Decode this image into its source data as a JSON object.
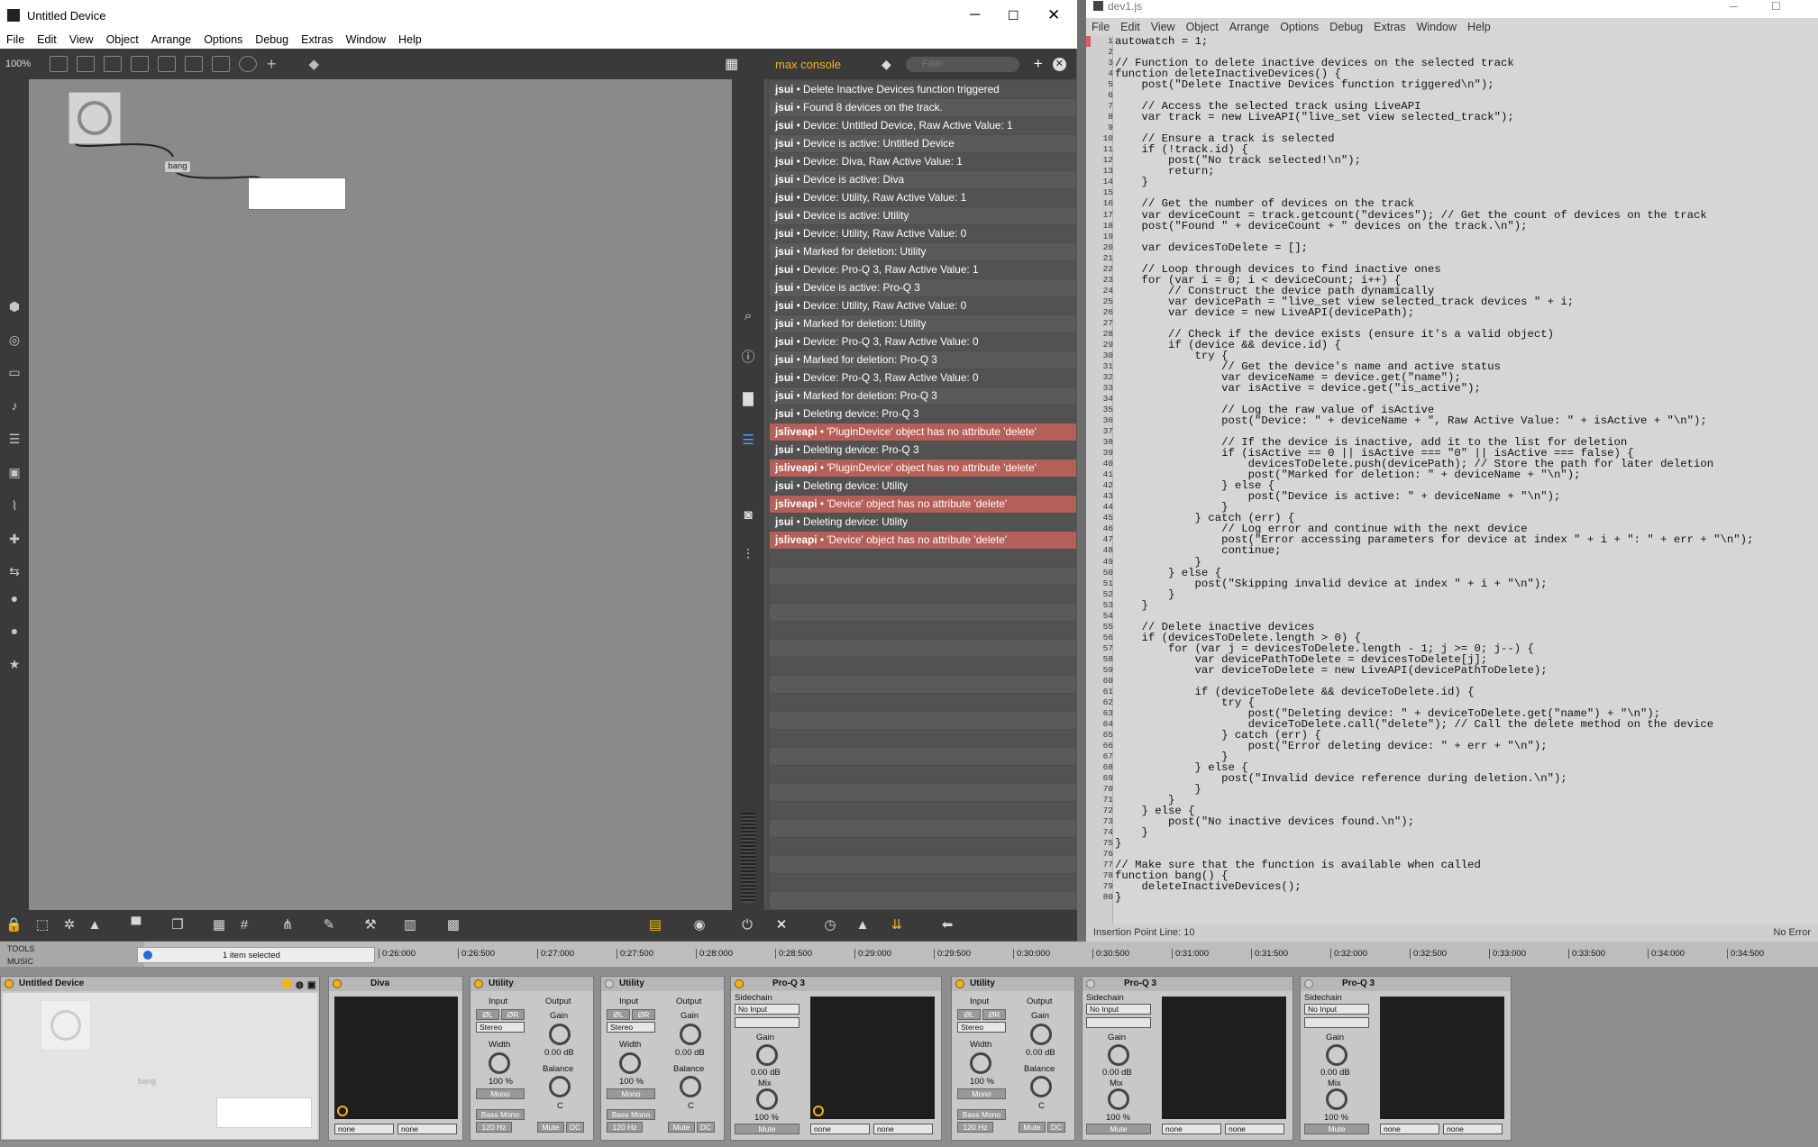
{
  "max_window": {
    "title": "Untitled Device",
    "menu": [
      "File",
      "Edit",
      "View",
      "Object",
      "Arrange",
      "Options",
      "Debug",
      "Extras",
      "Window",
      "Help"
    ],
    "zoom": "100%",
    "patch": {
      "bang_label": "bang"
    },
    "console": {
      "title": "max console",
      "filter_placeholder": "Filter",
      "rows": [
        {
          "src": "jsui",
          "msg": "Delete Inactive Devices function triggered",
          "error": false
        },
        {
          "src": "jsui",
          "msg": "Found 8 devices on the track.",
          "error": false
        },
        {
          "src": "jsui",
          "msg": "Device: Untitled Device, Raw Active Value: 1",
          "error": false
        },
        {
          "src": "jsui",
          "msg": "Device is active: Untitled Device",
          "error": false
        },
        {
          "src": "jsui",
          "msg": "Device: Diva, Raw Active Value: 1",
          "error": false
        },
        {
          "src": "jsui",
          "msg": "Device is active: Diva",
          "error": false
        },
        {
          "src": "jsui",
          "msg": "Device: Utility, Raw Active Value: 1",
          "error": false
        },
        {
          "src": "jsui",
          "msg": "Device is active: Utility",
          "error": false
        },
        {
          "src": "jsui",
          "msg": "Device: Utility, Raw Active Value: 0",
          "error": false
        },
        {
          "src": "jsui",
          "msg": "Marked for deletion: Utility",
          "error": false
        },
        {
          "src": "jsui",
          "msg": "Device: Pro-Q 3, Raw Active Value: 1",
          "error": false
        },
        {
          "src": "jsui",
          "msg": "Device is active: Pro-Q 3",
          "error": false
        },
        {
          "src": "jsui",
          "msg": "Device: Utility, Raw Active Value: 0",
          "error": false
        },
        {
          "src": "jsui",
          "msg": "Marked for deletion: Utility",
          "error": false
        },
        {
          "src": "jsui",
          "msg": "Device: Pro-Q 3, Raw Active Value: 0",
          "error": false
        },
        {
          "src": "jsui",
          "msg": "Marked for deletion: Pro-Q 3",
          "error": false
        },
        {
          "src": "jsui",
          "msg": "Device: Pro-Q 3, Raw Active Value: 0",
          "error": false
        },
        {
          "src": "jsui",
          "msg": "Marked for deletion: Pro-Q 3",
          "error": false
        },
        {
          "src": "jsui",
          "msg": "Deleting device: Pro-Q 3",
          "error": false
        },
        {
          "src": "jsliveapi",
          "msg": "'PluginDevice' object has no attribute 'delete'",
          "error": true
        },
        {
          "src": "jsui",
          "msg": "Deleting device: Pro-Q 3",
          "error": false
        },
        {
          "src": "jsliveapi",
          "msg": "'PluginDevice' object has no attribute 'delete'",
          "error": true
        },
        {
          "src": "jsui",
          "msg": "Deleting device: Utility",
          "error": false
        },
        {
          "src": "jsliveapi",
          "msg": "'Device' object has no attribute 'delete'",
          "error": true
        },
        {
          "src": "jsui",
          "msg": "Deleting device: Utility",
          "error": false
        },
        {
          "src": "jsliveapi",
          "msg": "'Device' object has no attribute 'delete'",
          "error": true
        }
      ]
    }
  },
  "code_window": {
    "title": "dev1.js",
    "menu": [
      "File",
      "Edit",
      "View",
      "Object",
      "Arrange",
      "Options",
      "Debug",
      "Extras",
      "Window",
      "Help"
    ],
    "status_left": "Insertion Point Line: 10",
    "status_right": "No Error",
    "code": "autowatch = 1;\n\n// Function to delete inactive devices on the selected track\nfunction deleteInactiveDevices() {\n    post(\"Delete Inactive Devices function triggered\\n\");\n\n    // Access the selected track using LiveAPI\n    var track = new LiveAPI(\"live_set view selected_track\");\n\n    // Ensure a track is selected\n    if (!track.id) {\n        post(\"No track selected!\\n\");\n        return;\n    }\n\n    // Get the number of devices on the track\n    var deviceCount = track.getcount(\"devices\"); // Get the count of devices on the track\n    post(\"Found \" + deviceCount + \" devices on the track.\\n\");\n\n    var devicesToDelete = [];\n\n    // Loop through devices to find inactive ones\n    for (var i = 0; i < deviceCount; i++) {\n        // Construct the device path dynamically\n        var devicePath = \"live_set view selected_track devices \" + i;\n        var device = new LiveAPI(devicePath);\n\n        // Check if the device exists (ensure it's a valid object)\n        if (device && device.id) {\n            try {\n                // Get the device's name and active status\n                var deviceName = device.get(\"name\");\n                var isActive = device.get(\"is_active\");\n\n                // Log the raw value of isActive\n                post(\"Device: \" + deviceName + \", Raw Active Value: \" + isActive + \"\\n\");\n\n                // If the device is inactive, add it to the list for deletion\n                if (isActive == 0 || isActive === \"0\" || isActive === false) {\n                    devicesToDelete.push(devicePath); // Store the path for later deletion\n                    post(\"Marked for deletion: \" + deviceName + \"\\n\");\n                } else {\n                    post(\"Device is active: \" + deviceName + \"\\n\");\n                }\n            } catch (err) {\n                // Log error and continue with the next device\n                post(\"Error accessing parameters for device at index \" + i + \": \" + err + \"\\n\");\n                continue;\n            }\n        } else {\n            post(\"Skipping invalid device at index \" + i + \"\\n\");\n        }\n    }\n\n    // Delete inactive devices\n    if (devicesToDelete.length > 0) {\n        for (var j = devicesToDelete.length - 1; j >= 0; j--) {\n            var devicePathToDelete = devicesToDelete[j];\n            var deviceToDelete = new LiveAPI(devicePathToDelete);\n\n            if (deviceToDelete && deviceToDelete.id) {\n                try {\n                    post(\"Deleting device: \" + deviceToDelete.get(\"name\") + \"\\n\");\n                    deviceToDelete.call(\"delete\"); // Call the delete method on the device\n                } catch (err) {\n                    post(\"Error deleting device: \" + err + \"\\n\");\n                }\n            } else {\n                post(\"Invalid device reference during deletion.\\n\");\n            }\n        }\n    } else {\n        post(\"No inactive devices found.\\n\");\n    }\n}\n\n// Make sure that the function is available when called\nfunction bang() {\n    deleteInactiveDevices();\n}"
  },
  "live": {
    "browser_items": [
      "TOOLS",
      "MUSIC"
    ],
    "selection_text": "1 item selected",
    "timeline": [
      "0:26:000",
      "0:26:500",
      "0:27:000",
      "0:27:500",
      "0:28:000",
      "0:28:500",
      "0:29:000",
      "0:29:500",
      "0:30:000",
      "0:30:500",
      "0:31:000",
      "0:31:500",
      "0:32:000",
      "0:32:500",
      "0:33:000",
      "0:33:500",
      "0:34:000",
      "0:34:500"
    ],
    "devices": {
      "untitled": {
        "name": "Untitled Device",
        "bang": "bang"
      },
      "diva": {
        "name": "Diva",
        "sel1": "none",
        "sel2": "none"
      },
      "utility1": {
        "name": "Utility",
        "input": "Input",
        "output": "Output",
        "phase_l": "ØL",
        "phase_r": "ØR",
        "mode": "Stereo",
        "width": "Width",
        "width_val": "100 %",
        "mono": "Mono",
        "bass_mono": "Bass Mono",
        "freq": "120 Hz",
        "gain": "Gain",
        "gain_val": "0.00 dB",
        "balance": "Balance",
        "balance_val": "C",
        "mute": "Mute",
        "dc": "DC"
      },
      "utility2": {
        "name": "Utility",
        "input": "Input",
        "output": "Output",
        "phase_l": "ØL",
        "phase_r": "ØR",
        "mode": "Stereo",
        "width": "Width",
        "width_val": "100 %",
        "mono": "Mono",
        "bass_mono": "Bass Mono",
        "freq": "120 Hz",
        "gain": "Gain",
        "gain_val": "0.00 dB",
        "balance": "Balance",
        "balance_val": "C",
        "mute": "Mute",
        "dc": "DC"
      },
      "proq1": {
        "name": "Pro-Q 3",
        "sidechain": "Sidechain",
        "sc_input": "No Input",
        "gain": "Gain",
        "gain_val": "0.00 dB",
        "mix": "Mix",
        "mix_val": "100 %",
        "mute": "Mute",
        "sel1": "none",
        "sel2": "none"
      },
      "utility3": {
        "name": "Utility",
        "input": "Input",
        "output": "Output",
        "phase_l": "ØL",
        "phase_r": "ØR",
        "mode": "Stereo",
        "width": "Width",
        "width_val": "100 %",
        "mono": "Mono",
        "bass_mono": "Bass Mono",
        "freq": "120 Hz",
        "gain": "Gain",
        "gain_val": "0.00 dB",
        "balance": "Balance",
        "balance_val": "C",
        "mute": "Mute",
        "dc": "DC"
      },
      "proq2": {
        "name": "Pro-Q 3",
        "sidechain": "Sidechain",
        "sc_input": "No Input",
        "gain": "Gain",
        "gain_val": "0.00 dB",
        "mix": "Mix",
        "mix_val": "100 %",
        "mute": "Mute",
        "sel1": "none",
        "sel2": "none"
      },
      "proq3": {
        "name": "Pro-Q 3",
        "sidechain": "Sidechain",
        "sc_input": "No Input",
        "gain": "Gain",
        "gain_val": "0.00 dB",
        "mix": "Mix",
        "mix_val": "100 %",
        "mute": "Mute",
        "sel1": "none",
        "sel2": "none"
      }
    }
  },
  "colors": {
    "console_error": "#b45f57",
    "accent_yellow": "#f3b21c",
    "console_title": "#f3b21c"
  }
}
